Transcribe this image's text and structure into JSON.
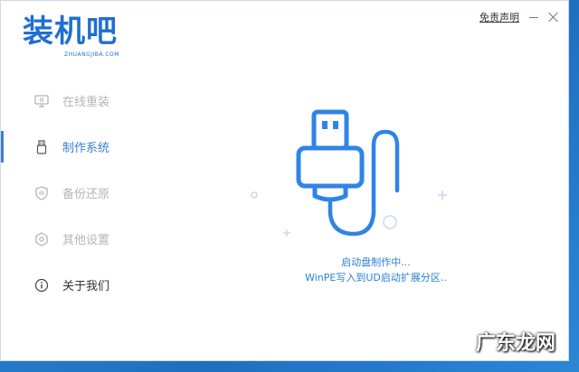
{
  "app": {
    "logo_text": "装机吧",
    "logo_sub": "ZHUANGJIBA.COM",
    "disclaimer": "免责声明"
  },
  "sidebar": {
    "items": [
      {
        "label": "在线重装",
        "icon": "monitor-icon"
      },
      {
        "label": "制作系统",
        "icon": "usb-drive-icon"
      },
      {
        "label": "备份还原",
        "icon": "shield-icon"
      },
      {
        "label": "其他设置",
        "icon": "gear-icon"
      },
      {
        "label": "关于我们",
        "icon": "info-icon"
      }
    ],
    "active_index": 1
  },
  "main": {
    "status_line1": "启动盘制作中...",
    "status_line2": "WinPE写入到UD启动扩展分区..",
    "illustration": "usb-cable-icon"
  },
  "watermark": "广东龙网",
  "colors": {
    "accent": "#3a7fd5",
    "logo": "#1f6fd0",
    "inactive_text": "#b5b5b5"
  }
}
